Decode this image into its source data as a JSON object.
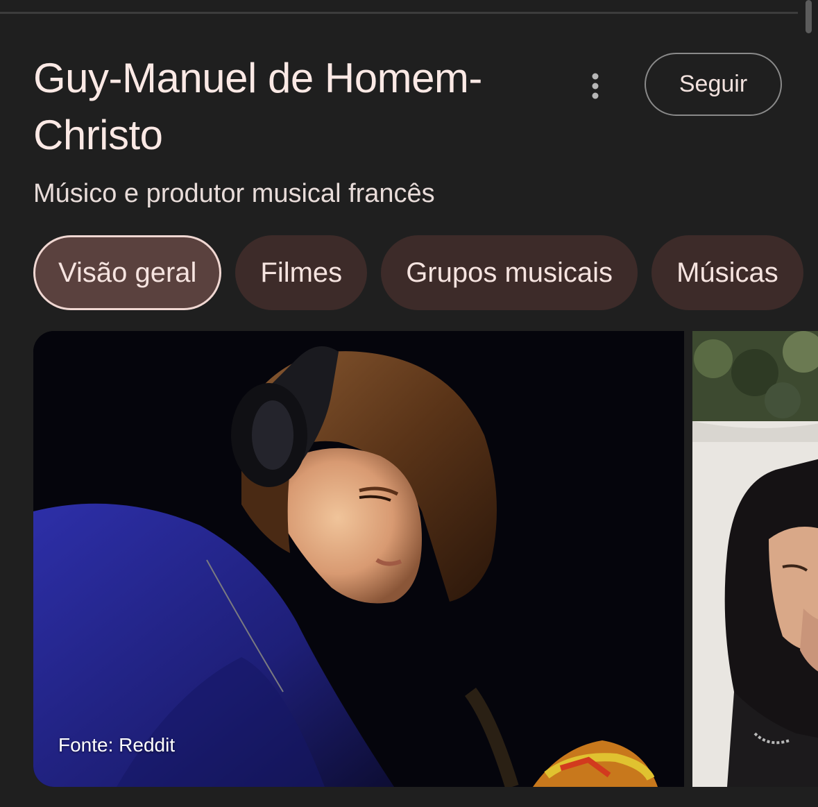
{
  "header": {
    "title": "Guy-Manuel de Homem-Christo",
    "subtitle": "Músico e produtor musical francês",
    "follow_label": "Seguir",
    "more_icon": "more-vert-icon"
  },
  "chips": [
    {
      "label": "Visão geral",
      "active": true
    },
    {
      "label": "Filmes",
      "active": false
    },
    {
      "label": "Grupos musicais",
      "active": false
    },
    {
      "label": "Músicas",
      "active": false
    }
  ],
  "images": [
    {
      "source": "Fonte: Reddit"
    }
  ],
  "colors": {
    "background": "#1f1f1f",
    "chip": "#3d2b29",
    "chip_active": "#5a413e",
    "text": "#fbe9e5"
  }
}
